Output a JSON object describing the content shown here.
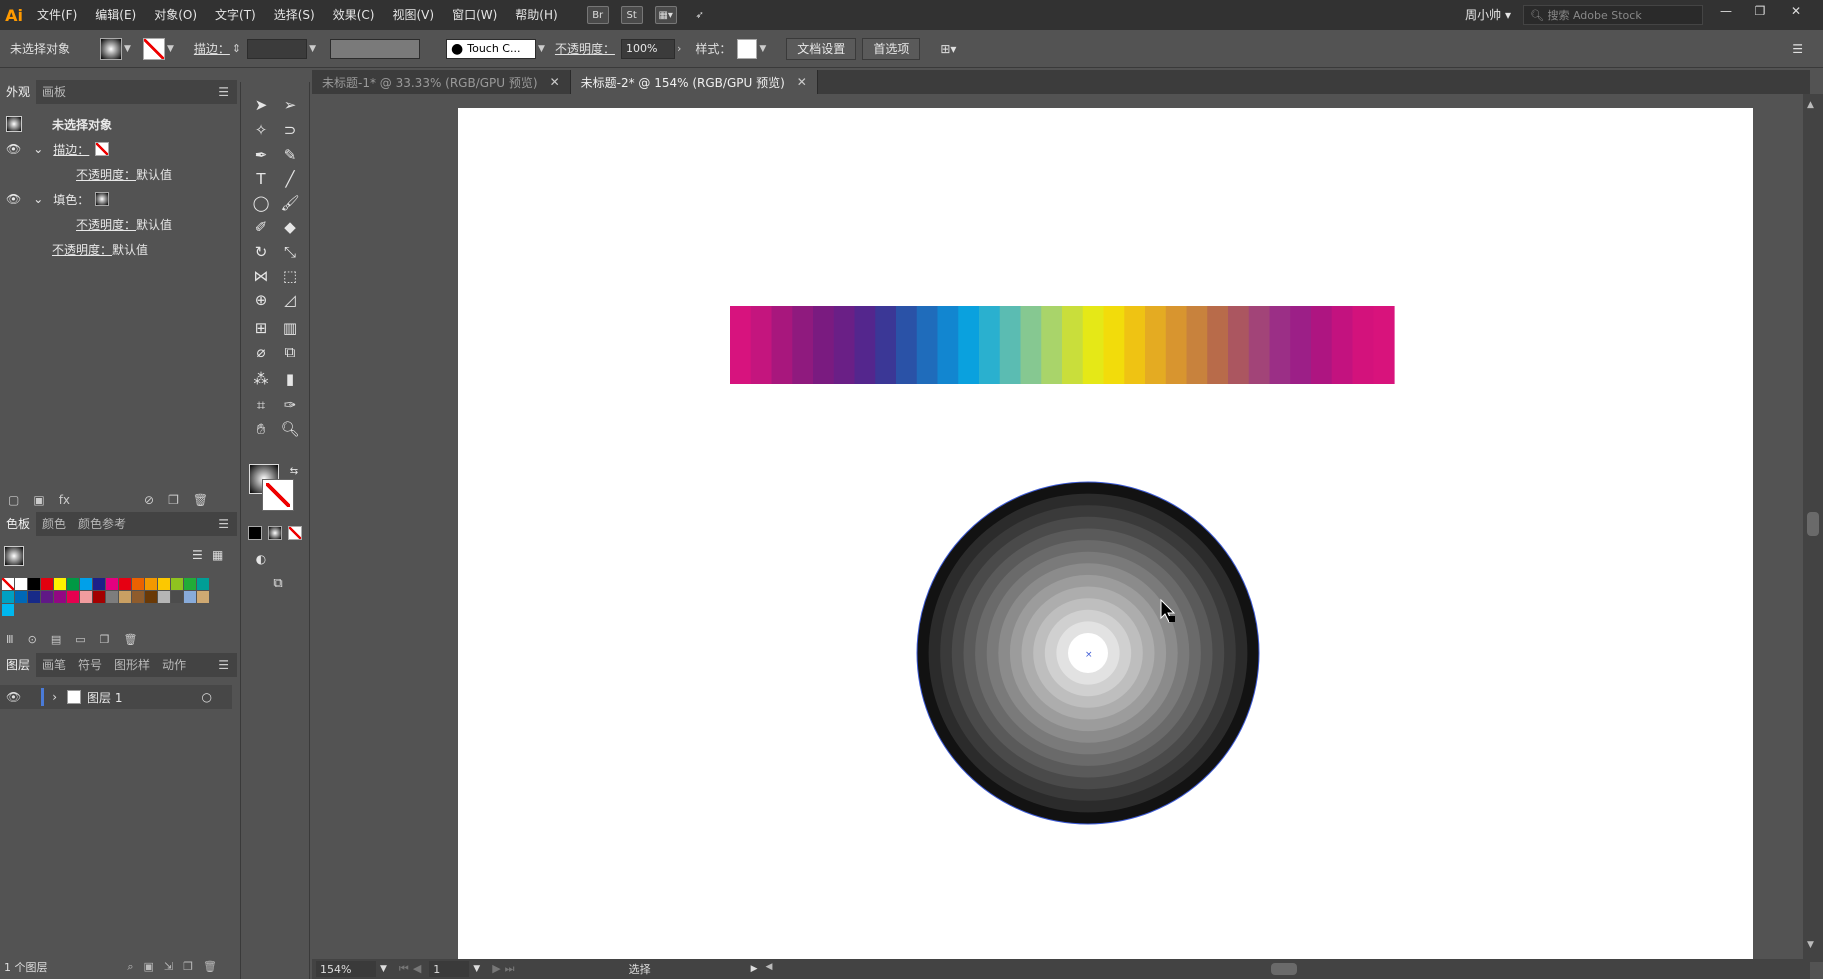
{
  "app": {
    "logo": "Ai"
  },
  "menu": [
    "文件(F)",
    "编辑(E)",
    "对象(O)",
    "文字(T)",
    "选择(S)",
    "效果(C)",
    "视图(V)",
    "窗口(W)",
    "帮助(H)"
  ],
  "menu_icons": {
    "bridge": "Br",
    "stock": "St"
  },
  "user": "周小帅",
  "stock_search_placeholder": "搜索 Adobe Stock",
  "control": {
    "selection": "未选择对象",
    "stroke_label": "描边：",
    "brush_name": "Touch C...",
    "opacity_label": "不透明度：",
    "opacity_value": "100%",
    "style_label": "样式：",
    "doc_setup": "文档设置",
    "preferences": "首选项"
  },
  "appearance": {
    "tabs": [
      "外观",
      "画板"
    ],
    "title": "未选择对象",
    "stroke": "描边：",
    "fill": "填色：",
    "opacity": "不透明度：",
    "default": "默认值"
  },
  "swatches": {
    "tabs": [
      "色板",
      "颜色",
      "颜色参考"
    ],
    "colors": [
      "#ffffff",
      "#000000",
      "#e3000f",
      "#fff100",
      "#009944",
      "#00a0e9",
      "#1d2088",
      "#e4007f",
      "#e60012",
      "#eb6100",
      "#f39800",
      "#fcc800",
      "#8fc31f",
      "#22ac38",
      "#009e96",
      "#00a0c1",
      "#0068b7",
      "#172a88",
      "#601986",
      "#920783",
      "#e5004f",
      "#f29c9f",
      "#a40000",
      "#7d7d7d",
      "#c9a063",
      "#8f5c2c",
      "#6a3906",
      "#b5b5b5",
      "#4c4c4c",
      "#88abda",
      "#cfa972",
      "#00b7ee"
    ]
  },
  "layers": {
    "tabs": [
      "图层",
      "画笔",
      "符号",
      "图形样",
      "动作"
    ],
    "layer_name": "图层 1",
    "footer": "1 个图层"
  },
  "documents": [
    {
      "title": "未标题-1* @ 33.33% (RGB/GPU 预览)",
      "active": false
    },
    {
      "title": "未标题-2* @ 154% (RGB/GPU 预览)",
      "active": true
    }
  ],
  "status": {
    "zoom": "154%",
    "page": "1",
    "tool": "选择"
  },
  "artwork": {
    "stripe_colors": [
      "#d7137e",
      "#c4157e",
      "#a8177d",
      "#8f1a7e",
      "#7a1b80",
      "#6a1f86",
      "#54268d",
      "#3b3796",
      "#2a52a7",
      "#1f6cbb",
      "#1286d0",
      "#0aa1de",
      "#2ab0cf",
      "#5bbcb2",
      "#86c891",
      "#a9d46a",
      "#c9de3b",
      "#e5e817",
      "#f2dc0b",
      "#efc313",
      "#e4ab22",
      "#d8952f",
      "#c8823d",
      "#b86b4a",
      "#ab5660",
      "#a24478",
      "#9b2f86",
      "#9c1f87",
      "#ae1581",
      "#c3127f",
      "#d3127c",
      "#d8137c"
    ],
    "rings": [
      "#121212",
      "#2b2b2b",
      "#3a3a3a",
      "#4a4a4a",
      "#5a5a5a",
      "#6a6a6a",
      "#7a7a7a",
      "#8b8b8b",
      "#9c9c9c",
      "#adadad",
      "#bebebe",
      "#d0d0d0",
      "#e2e2e2",
      "#ffffff"
    ]
  }
}
